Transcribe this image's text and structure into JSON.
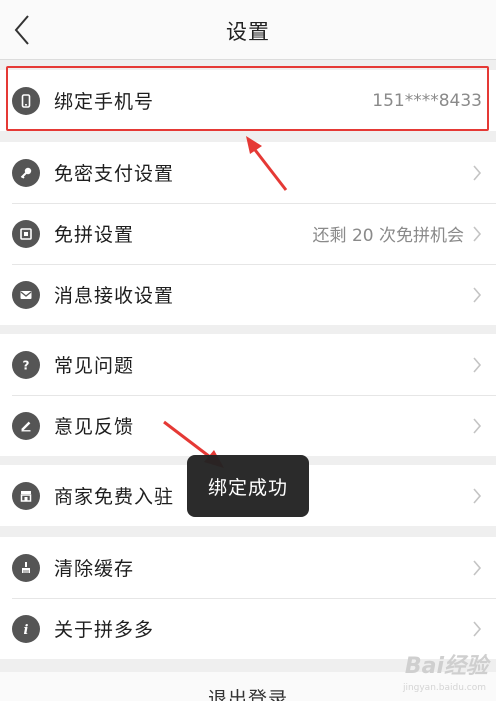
{
  "header": {
    "title": "设置"
  },
  "groups": [
    {
      "rows": [
        {
          "label": "绑定手机号",
          "value": "151****8433"
        }
      ]
    },
    {
      "rows": [
        {
          "label": "免密支付设置"
        },
        {
          "label": "免拼设置",
          "value": "还剩 20 次免拼机会"
        },
        {
          "label": "消息接收设置"
        }
      ]
    },
    {
      "rows": [
        {
          "label": "常见问题"
        },
        {
          "label": "意见反馈"
        }
      ]
    },
    {
      "rows": [
        {
          "label": "商家免费入驻"
        }
      ]
    },
    {
      "rows": [
        {
          "label": "清除缓存"
        },
        {
          "label": "关于拼多多"
        }
      ]
    }
  ],
  "toast": {
    "text": "绑定成功"
  },
  "logout": {
    "label": "退出登录"
  },
  "watermark": {
    "text": "Bai经验",
    "sub": "jingyan.baidu.com"
  },
  "colors": {
    "annotation": "#e53935",
    "icon": "#555555",
    "toast_bg": "#222222"
  }
}
